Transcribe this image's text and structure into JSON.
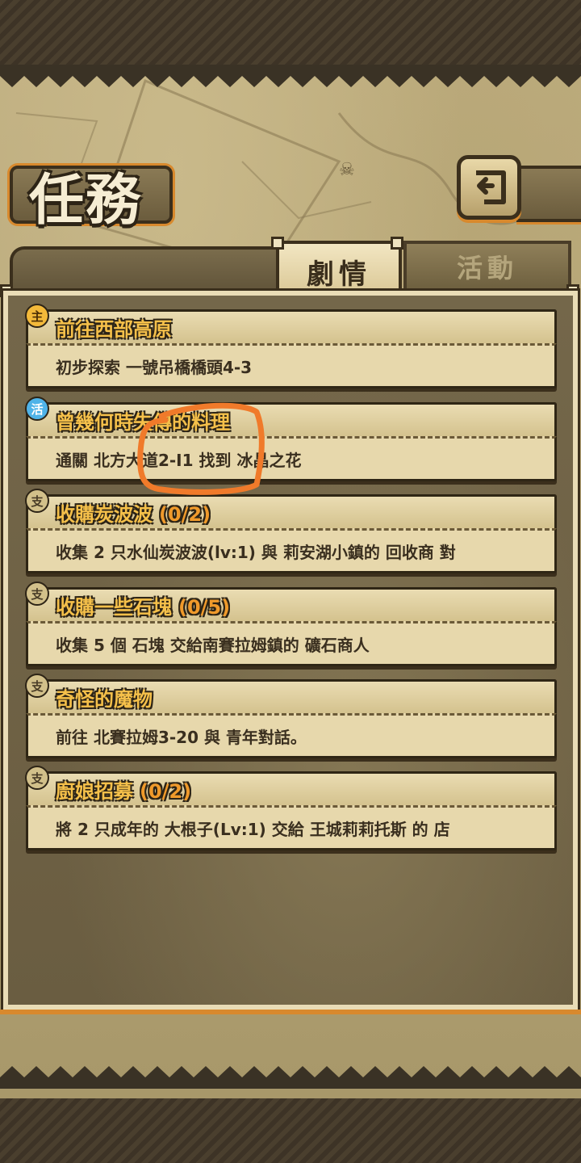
{
  "screen": {
    "title": "任務",
    "back_icon": "return-arrow-icon"
  },
  "tabs": [
    {
      "label": "劇情",
      "active": true
    },
    {
      "label": "活動",
      "active": false
    }
  ],
  "quests": [
    {
      "badge": "主",
      "badge_type": "main",
      "title": "前往西部高原",
      "progress": "",
      "description": "初步探索 一號吊橋橋頭4-3"
    },
    {
      "badge": "活",
      "badge_type": "event",
      "title": "曾幾何時失傳的料理",
      "progress": "",
      "description": "通關 北方大道2-I1 找到 冰晶之花"
    },
    {
      "badge": "支",
      "badge_type": "side",
      "title": "收購炭波波",
      "progress": "(0/2)",
      "description": "收集 2 只水仙炭波波(lv:1) 與 莉安湖小鎮的 回收商 對"
    },
    {
      "badge": "支",
      "badge_type": "side",
      "title": "收購一些石塊",
      "progress": "(0/5)",
      "description": "收集 5 個 石塊 交給南賽拉姆鎮的 礦石商人"
    },
    {
      "badge": "支",
      "badge_type": "side",
      "title": "奇怪的魔物",
      "progress": "",
      "description": "前往 北賽拉姆3-20 與 青年對話。"
    },
    {
      "badge": "支",
      "badge_type": "side",
      "title": "廚娘招募",
      "progress": "(0/2)",
      "description": "將 2 只成年的 大根子(Lv:1) 交給 王城莉莉托斯 的 店"
    }
  ],
  "colors": {
    "title_gold": "#f5c04a",
    "progress_orange": "#f09a2b",
    "accent_orange": "#d8892d",
    "annotation_orange": "#f07a2a"
  }
}
